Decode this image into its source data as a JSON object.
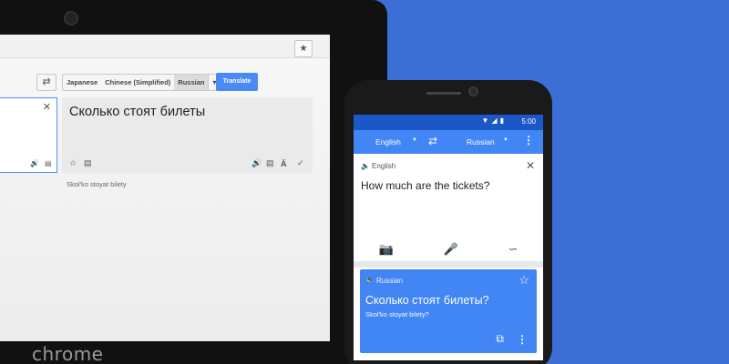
{
  "laptop": {
    "brand": "chrome",
    "lang_tabs": [
      "Japanese",
      "Chinese (Simplified)",
      "Russian"
    ],
    "translate_label": "Translate",
    "output_text": "Сколько стоят билеты",
    "transliteration": "Skol'ko stoyat bilety"
  },
  "phone": {
    "time": "5:00",
    "source_lang": "English",
    "target_lang": "Russian",
    "input_label": "English",
    "input_text": "How much are the tickets?",
    "result_label": "Russian",
    "result_text": "Сколько стоят билеты?",
    "result_translit": "Skol'ko stoyat bilety?"
  },
  "colors": {
    "background": "#3b6fd6",
    "accent": "#4285f4",
    "status": "#1c57c7"
  }
}
